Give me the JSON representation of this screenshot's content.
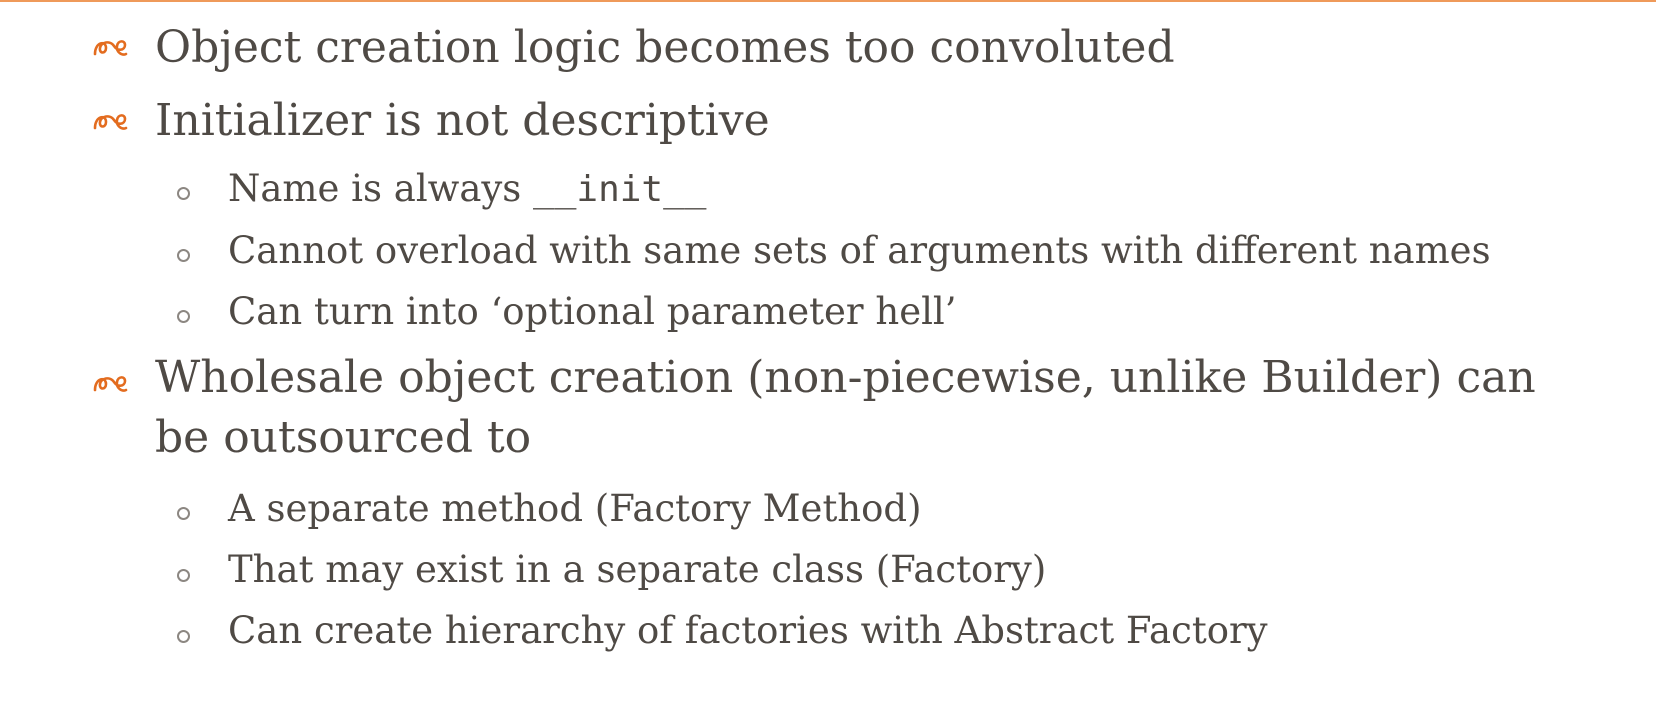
{
  "slide": {
    "bullets": [
      {
        "text": "Object creation logic becomes too convoluted"
      },
      {
        "text": "Initializer is not descriptive",
        "subitems": [
          {
            "prefix": "Name is always ",
            "code": "__init__"
          },
          {
            "text": "Cannot overload with same sets of arguments with different names"
          },
          {
            "text": "Can turn into ‘optional parameter hell’"
          }
        ]
      },
      {
        "text": "Wholesale object creation (non-piecewise, unlike Builder) can be outsourced to",
        "subitems": [
          {
            "text": "A separate method (Factory Method)"
          },
          {
            "text": "That may exist in a separate class (Factory)"
          },
          {
            "text": "Can create hierarchy of factories with Abstract Factory"
          }
        ]
      }
    ],
    "bullet_glyph": "ꩠ",
    "icons": {
      "bullet": "flourish-bullet-icon",
      "subbullet": "hollow-circle-bullet-icon"
    },
    "colors": {
      "accent": "#e36c1f",
      "text": "#4f4a45",
      "rule": "#ef9a5a"
    }
  }
}
